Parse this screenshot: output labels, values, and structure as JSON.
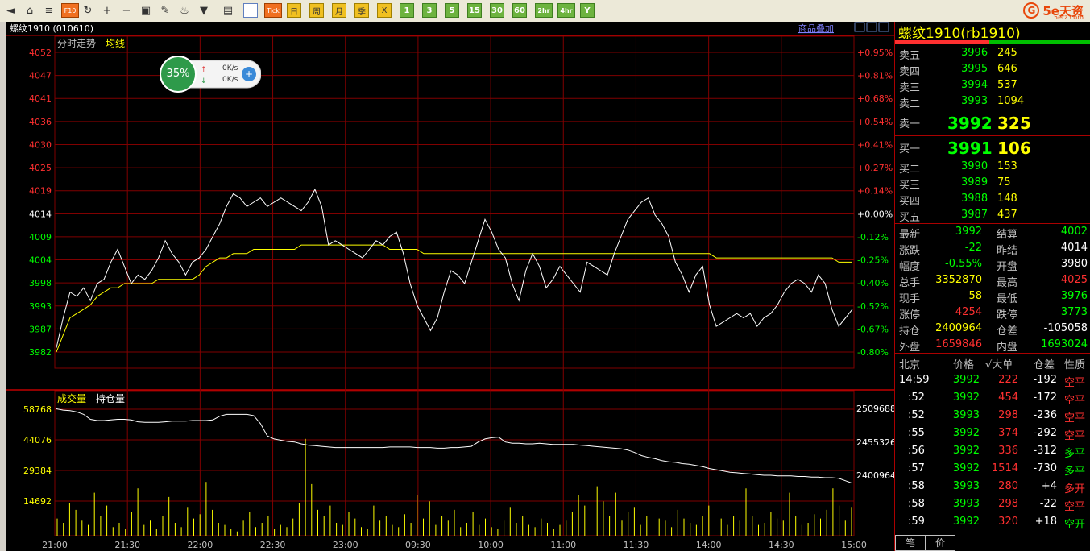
{
  "toolbar": {
    "buttons": [
      {
        "name": "back-icon",
        "label": "◄",
        "style": "icon"
      },
      {
        "name": "home-icon",
        "label": "⌂",
        "style": "icon"
      },
      {
        "name": "grid-icon",
        "label": "≡",
        "style": "icon"
      },
      {
        "name": "f10-icon",
        "label": "F10",
        "style": "orange"
      },
      {
        "name": "refresh-icon",
        "label": "↻",
        "style": "icon"
      },
      {
        "name": "zoom-in-icon",
        "label": "+",
        "style": "icon"
      },
      {
        "name": "zoom-out-icon",
        "label": "−",
        "style": "icon"
      },
      {
        "name": "window-icon",
        "label": "▣",
        "style": "icon"
      },
      {
        "name": "pen-icon",
        "label": "✎",
        "style": "icon"
      },
      {
        "name": "paint-icon",
        "label": "♨",
        "style": "icon"
      },
      {
        "name": "filter-icon",
        "label": "▼",
        "style": "icon"
      },
      {
        "name": "table-icon",
        "label": "▤",
        "style": "icon"
      },
      {
        "name": "timechart-icon",
        "label": "↗",
        "style": "active"
      },
      {
        "name": "tick-button",
        "label": "Tick",
        "style": "orange"
      },
      {
        "name": "day-button",
        "label": "日",
        "style": "yellow"
      },
      {
        "name": "week-button",
        "label": "周",
        "style": "yellow"
      },
      {
        "name": "month-button",
        "label": "月",
        "style": "yellow"
      },
      {
        "name": "season-button",
        "label": "季",
        "style": "yellow"
      },
      {
        "name": "year-button",
        "label": "X",
        "style": "yellow"
      },
      {
        "name": "min1-button",
        "label": "1",
        "style": "green"
      },
      {
        "name": "min3-button",
        "label": "3",
        "style": "green"
      },
      {
        "name": "min5-button",
        "label": "5",
        "style": "green"
      },
      {
        "name": "min15-button",
        "label": "15",
        "style": "green"
      },
      {
        "name": "min30-button",
        "label": "30",
        "style": "green"
      },
      {
        "name": "min60-button",
        "label": "60",
        "style": "green"
      },
      {
        "name": "hr2-button",
        "label": "2hr",
        "style": "green"
      },
      {
        "name": "hr4-button",
        "label": "4hr",
        "style": "green"
      },
      {
        "name": "y-button",
        "label": "Y",
        "style": "green"
      }
    ],
    "logo": {
      "mark": "G",
      "text": "5e天资",
      "sub": "5etz.com"
    }
  },
  "chart": {
    "title": "螺纹1910 (010610)",
    "overlay_link": "商品叠加",
    "upper_label": "分时走势",
    "avg_label": "均线",
    "lower_label1": "成交量",
    "lower_label2": "持仓量",
    "price_ticks": [
      "4052",
      "4047",
      "4041",
      "4036",
      "4030",
      "4025",
      "4019",
      "4014",
      "4009",
      "4004",
      "3998",
      "3993",
      "3987",
      "3982"
    ],
    "pct_ticks": [
      "+0.95%",
      "+0.81%",
      "+0.68%",
      "+0.54%",
      "+0.41%",
      "+0.27%",
      "+0.14%",
      "+0.00%",
      "-0.12%",
      "-0.25%",
      "-0.40%",
      "-0.52%",
      "-0.67%",
      "-0.80%"
    ],
    "vol_ticks": [
      "58768",
      "44076",
      "29384",
      "14692"
    ],
    "oi_ticks": [
      "2509688",
      "2455326",
      "2400964"
    ],
    "time_ticks": [
      "21:00",
      "21:30",
      "22:00",
      "22:30",
      "23:00",
      "09:30",
      "10:00",
      "11:00",
      "11:30",
      "14:00",
      "14:30",
      "15:00"
    ]
  },
  "chart_data": {
    "type": "line",
    "ylim": [
      3979,
      4055
    ],
    "preclose": 4014,
    "price": [
      3983,
      3990,
      3996,
      3995,
      3997,
      3994,
      3998,
      3999,
      4003,
      4006,
      4002,
      3998,
      4000,
      3999,
      4001,
      4004,
      4008,
      4005,
      4003,
      4000,
      4003,
      4004,
      4006,
      4009,
      4012,
      4016,
      4019,
      4018,
      4016,
      4017,
      4018,
      4016,
      4017,
      4018,
      4017,
      4016,
      4015,
      4017,
      4020,
      4016,
      4007,
      4008,
      4007,
      4006,
      4005,
      4004,
      4006,
      4008,
      4007,
      4009,
      4010,
      4005,
      3998,
      3993,
      3990,
      3987,
      3990,
      3996,
      4001,
      4000,
      3998,
      4003,
      4008,
      4013,
      4010,
      4006,
      4004,
      3998,
      3994,
      4001,
      4005,
      4002,
      3997,
      3999,
      4002,
      4000,
      3998,
      3996,
      4003,
      4002,
      4001,
      4000,
      4005,
      4009,
      4013,
      4015,
      4017,
      4018,
      4014,
      4012,
      4009,
      4003,
      4000,
      3996,
      4000,
      4002,
      3993,
      3988,
      3989,
      3990,
      3991,
      3990,
      3991,
      3988,
      3990,
      3991,
      3993,
      3996,
      3998,
      3999,
      3998,
      3996,
      4000,
      3998,
      3992,
      3988,
      3990,
      3992
    ],
    "avg": [
      3982,
      3986,
      3990,
      3991,
      3992,
      3993,
      3995,
      3996,
      3997,
      3997,
      3998,
      3998,
      3998,
      3998,
      3998,
      3999,
      3999,
      3999,
      3999,
      3999,
      3999,
      4000,
      4002,
      4003,
      4004,
      4004,
      4005,
      4005,
      4005,
      4006,
      4006,
      4006,
      4006,
      4006,
      4006,
      4006,
      4007,
      4007,
      4007,
      4007,
      4007,
      4007,
      4007,
      4007,
      4007,
      4007,
      4007,
      4007,
      4007,
      4006,
      4006,
      4006,
      4006,
      4006,
      4005,
      4005,
      4005,
      4005,
      4005,
      4005,
      4005,
      4005,
      4005,
      4005,
      4005,
      4005,
      4005,
      4005,
      4005,
      4005,
      4005,
      4005,
      4005,
      4005,
      4005,
      4005,
      4005,
      4005,
      4005,
      4005,
      4005,
      4005,
      4005,
      4005,
      4005,
      4005,
      4005,
      4005,
      4005,
      4005,
      4005,
      4005,
      4005,
      4005,
      4005,
      4005,
      4005,
      4004,
      4004,
      4004,
      4004,
      4004,
      4004,
      4004,
      4004,
      4004,
      4004,
      4004,
      4004,
      4004,
      4004,
      4004,
      4004,
      4004,
      4004,
      4003,
      4003,
      4003
    ],
    "oi": [
      2509000,
      2507000,
      2506000,
      2504000,
      2500000,
      2492000,
      2490000,
      2490000,
      2491000,
      2492000,
      2492000,
      2491000,
      2488000,
      2487000,
      2487000,
      2487000,
      2488000,
      2489000,
      2489000,
      2489000,
      2490000,
      2490000,
      2490000,
      2491000,
      2497000,
      2500000,
      2500000,
      2500000,
      2500000,
      2498000,
      2485000,
      2465000,
      2460000,
      2458000,
      2456000,
      2455000,
      2452000,
      2450000,
      2449000,
      2448000,
      2447000,
      2446000,
      2446000,
      2446000,
      2446000,
      2446000,
      2446000,
      2446000,
      2446000,
      2447000,
      2447000,
      2447000,
      2447000,
      2446000,
      2446000,
      2446000,
      2445000,
      2445000,
      2446000,
      2446000,
      2447000,
      2448000,
      2455000,
      2460000,
      2462000,
      2463000,
      2455000,
      2453000,
      2453000,
      2452000,
      2452000,
      2453000,
      2452000,
      2451000,
      2451000,
      2451000,
      2451000,
      2450000,
      2449000,
      2448000,
      2447000,
      2446000,
      2445000,
      2444000,
      2442000,
      2438000,
      2433000,
      2430000,
      2428000,
      2425000,
      2423000,
      2422000,
      2420000,
      2419000,
      2417000,
      2415000,
      2412000,
      2410000,
      2408000,
      2406000,
      2405000,
      2404000,
      2403000,
      2402000,
      2401000,
      2401000,
      2400000,
      2400000,
      2400000,
      2399000,
      2399000,
      2398000,
      2398000,
      2397000,
      2397000,
      2396000,
      2392000,
      2388000
    ],
    "volume": [
      8000,
      6000,
      15000,
      12000,
      7000,
      5000,
      20000,
      9000,
      14000,
      4000,
      6000,
      3000,
      11000,
      22000,
      5000,
      7000,
      3000,
      9000,
      18000,
      6000,
      4000,
      13000,
      8000,
      10000,
      25000,
      12000,
      6000,
      5000,
      3000,
      2000,
      7000,
      11000,
      4000,
      6000,
      9000,
      3000,
      5000,
      4000,
      8000,
      15000,
      45000,
      24000,
      12000,
      9000,
      14000,
      6000,
      5000,
      11000,
      8000,
      4000,
      3000,
      14000,
      7000,
      9000,
      5000,
      4000,
      10000,
      6000,
      19000,
      8000,
      16000,
      5000,
      9000,
      7000,
      12000,
      4000,
      6000,
      11000,
      5000,
      8000,
      4000,
      3000,
      7000,
      13000,
      6000,
      9000,
      5000,
      4000,
      8000,
      6000,
      3000,
      5000,
      7000,
      11000,
      19000,
      14000,
      8000,
      23000,
      16000,
      9000,
      20000,
      7000,
      11000,
      13000,
      5000,
      9000,
      6000,
      8000,
      7000,
      4000,
      12000,
      8000,
      6000,
      5000,
      9000,
      14000,
      6000,
      8000,
      5000,
      9000,
      7000,
      22000,
      9000,
      5000,
      6000,
      11000,
      8000,
      7000,
      20000,
      9000,
      5000,
      6000,
      10000,
      8000,
      12000,
      22000,
      14000,
      7000,
      13000
    ]
  },
  "panel": {
    "title": "螺纹1910(rb1910)",
    "asks": [
      {
        "label": "卖五",
        "price": "3996",
        "vol": "245"
      },
      {
        "label": "卖四",
        "price": "3995",
        "vol": "646"
      },
      {
        "label": "卖三",
        "price": "3994",
        "vol": "537"
      },
      {
        "label": "卖二",
        "price": "3993",
        "vol": "1094"
      }
    ],
    "ask1": {
      "label": "卖一",
      "price": "3992",
      "vol": "325"
    },
    "bid1": {
      "label": "买一",
      "price": "3991",
      "vol": "106"
    },
    "bids": [
      {
        "label": "买二",
        "price": "3990",
        "vol": "153"
      },
      {
        "label": "买三",
        "price": "3989",
        "vol": "75"
      },
      {
        "label": "买四",
        "price": "3988",
        "vol": "148"
      },
      {
        "label": "买五",
        "price": "3987",
        "vol": "437"
      }
    ],
    "stats": [
      {
        "l1": "最新",
        "v1": "3992",
        "c1": "green",
        "l2": "结算",
        "v2": "4002",
        "c2": "green"
      },
      {
        "l1": "涨跌",
        "v1": "-22",
        "c1": "green",
        "l2": "昨结",
        "v2": "4014",
        "c2": "white"
      },
      {
        "l1": "幅度",
        "v1": "-0.55%",
        "c1": "green",
        "l2": "开盘",
        "v2": "3980",
        "c2": "white"
      },
      {
        "l1": "总手",
        "v1": "3352870",
        "c1": "yellow",
        "l2": "最高",
        "v2": "4025",
        "c2": "red"
      },
      {
        "l1": "现手",
        "v1": "58",
        "c1": "yellow",
        "l2": "最低",
        "v2": "3976",
        "c2": "green"
      },
      {
        "l1": "涨停",
        "v1": "4254",
        "c1": "red",
        "l2": "跌停",
        "v2": "3773",
        "c2": "green"
      },
      {
        "l1": "持仓",
        "v1": "2400964",
        "c1": "yellow",
        "l2": "仓差",
        "v2": "-105058",
        "c2": "white"
      },
      {
        "l1": "外盘",
        "v1": "1659846",
        "c1": "red",
        "l2": "内盘",
        "v2": "1693024",
        "c2": "green"
      }
    ],
    "trade_header": [
      "北京",
      "价格",
      "√大单",
      "仓差",
      "性质"
    ],
    "trades": [
      {
        "time": "14:59",
        "price": "3992",
        "vol": "222",
        "oi": "-192",
        "type": "空平",
        "tc": "red"
      },
      {
        "time": ":52",
        "price": "3992",
        "vol": "454",
        "oi": "-172",
        "type": "空平",
        "tc": "red"
      },
      {
        "time": ":52",
        "price": "3993",
        "vol": "298",
        "oi": "-236",
        "type": "空平",
        "tc": "red"
      },
      {
        "time": ":55",
        "price": "3992",
        "vol": "374",
        "oi": "-292",
        "type": "空平",
        "tc": "red"
      },
      {
        "time": ":56",
        "price": "3992",
        "vol": "336",
        "oi": "-312",
        "type": "多平",
        "tc": "green"
      },
      {
        "time": ":57",
        "price": "3992",
        "vol": "1514",
        "oi": "-730",
        "type": "多平",
        "tc": "green"
      },
      {
        "time": ":58",
        "price": "3993",
        "vol": "280",
        "oi": "+4",
        "type": "多开",
        "tc": "red"
      },
      {
        "time": ":58",
        "price": "3993",
        "vol": "298",
        "oi": "-22",
        "type": "空平",
        "tc": "red"
      },
      {
        "time": ":59",
        "price": "3992",
        "vol": "320",
        "oi": "+18",
        "type": "空开",
        "tc": "green"
      }
    ],
    "tabs": [
      "笔",
      "价"
    ]
  },
  "badge": {
    "percent": "35%",
    "up": "0K/s",
    "down": "0K/s"
  },
  "colors": {
    "grid": "#800000",
    "price": "#ffffff",
    "avg": "#ffff00",
    "volume": "#ffff00",
    "up": "#ff3030",
    "down": "#00ff00"
  }
}
